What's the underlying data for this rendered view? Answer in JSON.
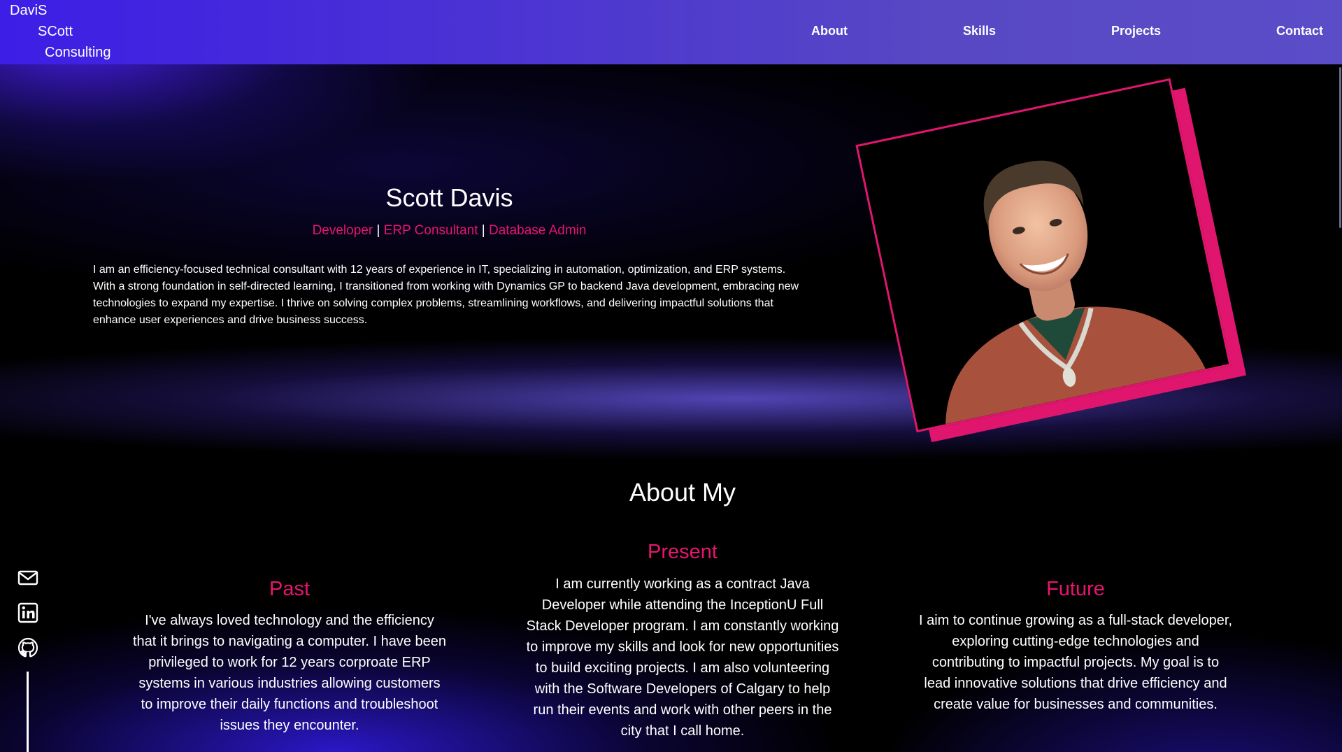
{
  "logo": {
    "line1": "DaviS",
    "line2": "SCott",
    "line3": "Consulting"
  },
  "nav": {
    "about": "About",
    "skills": "Skills",
    "projects": "Projects",
    "contact": "Contact"
  },
  "hero": {
    "name": "Scott Davis",
    "roles": [
      "Developer",
      "ERP Consultant",
      "Database Admin"
    ],
    "separator": " | ",
    "bio": "I am an efficiency-focused technical consultant with 12 years of experience in IT, specializing in automation, optimization, and ERP systems. With a strong foundation in self-directed learning, I transitioned from working with Dynamics GP to backend Java development, embracing new technologies to expand my expertise. I thrive on solving complex problems, streamlining workflows, and delivering impactful solutions that enhance user experiences and drive business success."
  },
  "about": {
    "title": "About My",
    "past": {
      "heading": "Past",
      "text": "I've always loved technology and the efficiency that it brings to navigating a computer. I have been privileged to work for 12 years corproate ERP systems in various industries allowing customers to improve their daily functions and troubleshoot issues they encounter."
    },
    "present": {
      "heading": "Present",
      "text": "I am currently working as a contract Java Developer while attending the InceptionU Full Stack Developer program. I am constantly working to improve my skills and look for new opportunities to build exciting projects. I am also volunteering with the Software Developers of Calgary to help run their events and work with other peers in the city that I call home."
    },
    "future": {
      "heading": "Future",
      "text": "I aim to continue growing as a full-stack developer, exploring cutting-edge technologies and contributing to impactful projects. My goal is to lead innovative solutions that drive efficiency and create value for businesses and communities."
    }
  },
  "social": {
    "icons": [
      "mail-icon",
      "linkedin-icon",
      "github-icon"
    ]
  },
  "colors": {
    "accent": "#e8156e",
    "nav": "#4a32d4",
    "background": "#000000"
  }
}
